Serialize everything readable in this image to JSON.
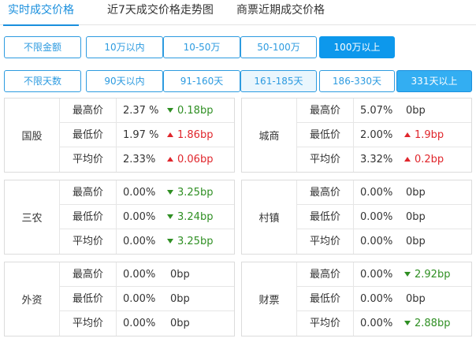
{
  "tabs": [
    {
      "label": "实时成交价格",
      "active": true
    },
    {
      "label": "近7天成交价格走势图",
      "active": false
    },
    {
      "label": "商票近期成交价格",
      "active": false
    }
  ],
  "amount_filters": [
    {
      "label": "不限金额",
      "state": "normal"
    },
    {
      "label": "10万以内",
      "state": "normal"
    },
    {
      "label": "10-50万",
      "state": "normal"
    },
    {
      "label": "50-100万",
      "state": "normal"
    },
    {
      "label": "100万以上",
      "state": "selected"
    }
  ],
  "days_filters": [
    {
      "label": "不限天数",
      "state": "normal"
    },
    {
      "label": "90天以内",
      "state": "normal"
    },
    {
      "label": "91-160天",
      "state": "normal"
    },
    {
      "label": "161-185天",
      "state": "hover"
    },
    {
      "label": "186-330天",
      "state": "normal"
    },
    {
      "label": "331天以上",
      "state": "selected"
    }
  ],
  "colors": {
    "accent": "#0d98ec",
    "up": "#e0262c",
    "down": "#2f8f23"
  },
  "cards": [
    {
      "name": "国股",
      "rows": [
        {
          "label": "最高价",
          "value": "2.37 %",
          "change": "0.18bp",
          "dir": "down"
        },
        {
          "label": "最低价",
          "value": "1.97 %",
          "change": "1.86bp",
          "dir": "up"
        },
        {
          "label": "平均价",
          "value": "2.33%",
          "change": "0.06bp",
          "dir": "up"
        }
      ]
    },
    {
      "name": "城商",
      "rows": [
        {
          "label": "最高价",
          "value": "5.07%",
          "change": "0bp",
          "dir": "none"
        },
        {
          "label": "最低价",
          "value": "2.00%",
          "change": "1.9bp",
          "dir": "up"
        },
        {
          "label": "平均价",
          "value": "3.32%",
          "change": "0.2bp",
          "dir": "up"
        }
      ]
    },
    {
      "name": "三农",
      "rows": [
        {
          "label": "最高价",
          "value": "0.00%",
          "change": "3.25bp",
          "dir": "down"
        },
        {
          "label": "最低价",
          "value": "0.00%",
          "change": "3.24bp",
          "dir": "down"
        },
        {
          "label": "平均价",
          "value": "0.00%",
          "change": "3.25bp",
          "dir": "down"
        }
      ]
    },
    {
      "name": "村镇",
      "rows": [
        {
          "label": "最高价",
          "value": "0.00%",
          "change": "0bp",
          "dir": "none"
        },
        {
          "label": "最低价",
          "value": "0.00%",
          "change": "0bp",
          "dir": "none"
        },
        {
          "label": "平均价",
          "value": "0.00%",
          "change": "0bp",
          "dir": "none"
        }
      ]
    },
    {
      "name": "外资",
      "rows": [
        {
          "label": "最高价",
          "value": "0.00%",
          "change": "0bp",
          "dir": "none"
        },
        {
          "label": "最低价",
          "value": "0.00%",
          "change": "0bp",
          "dir": "none"
        },
        {
          "label": "平均价",
          "value": "0.00%",
          "change": "0bp",
          "dir": "none"
        }
      ]
    },
    {
      "name": "财票",
      "rows": [
        {
          "label": "最高价",
          "value": "0.00%",
          "change": "2.92bp",
          "dir": "down"
        },
        {
          "label": "最低价",
          "value": "0.00%",
          "change": "0bp",
          "dir": "none"
        },
        {
          "label": "平均价",
          "value": "0.00%",
          "change": "2.88bp",
          "dir": "down"
        }
      ]
    }
  ]
}
